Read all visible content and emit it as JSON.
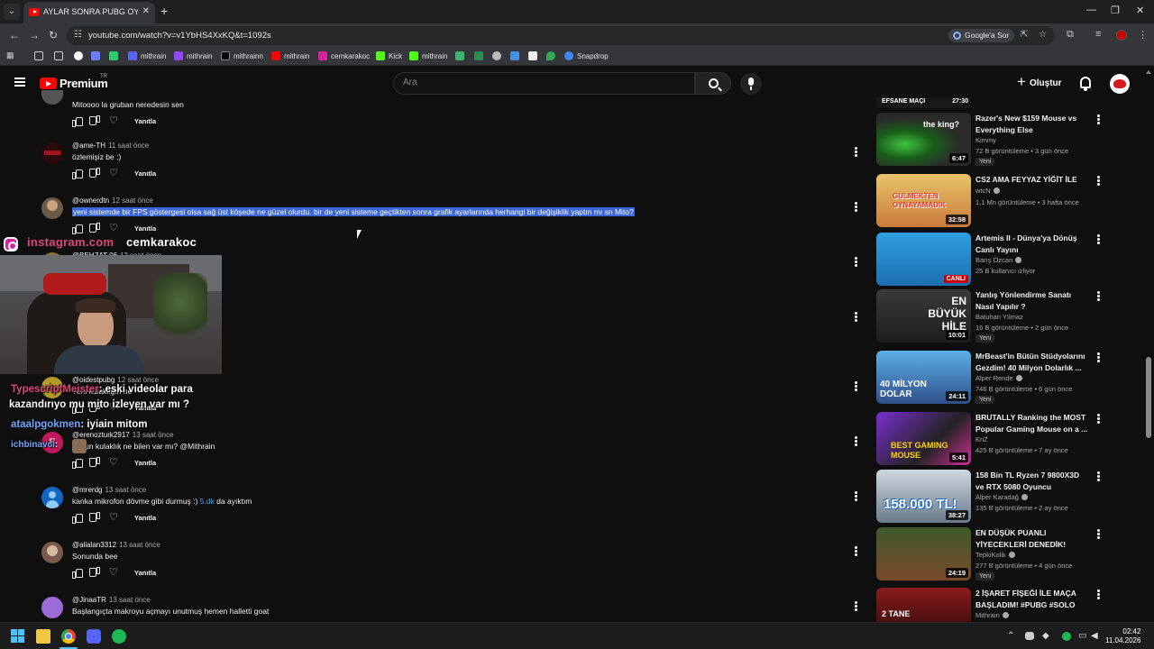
{
  "browser": {
    "tab_title": "AYLAR SONRA PUBG OYNADIM",
    "url": "youtube.com/watch?v=v1YbHS4XxKQ&t=1092s",
    "google_sor": "Google'a Sor",
    "bookmarks": [
      "mithrain",
      "mithrain",
      "mithrainn",
      "mithrain",
      "cemkarakoc",
      "Kick",
      "mithrain",
      "Snapdrop"
    ]
  },
  "header": {
    "premium": "Premium",
    "region": "TR",
    "search_placeholder": "Ara",
    "create": "Oluştur"
  },
  "comments": [
    {
      "user": "",
      "time": "",
      "text": "Mitoooo la gruban neredesin sen",
      "reply": "Yanıtla"
    },
    {
      "user": "@ame-TH",
      "time": "11 saat önce",
      "text": "özlemişiz be :)",
      "reply": "Yanıtla"
    },
    {
      "user": "@ownerdtn",
      "time": "12 saat önce",
      "text": "yeni sistemde bir FPS göstergesi olsa sağ üst köşede ne güzel olurdu. bir de yeni sisteme geçtikten sonra grafik ayarlarında herhangi bir değişiklik yaptın mı sn Mito?",
      "reply": "Yanıtla"
    },
    {
      "user": "@BEHZAT 06",
      "time": "12 saat önce",
      "text": "",
      "reply": ""
    },
    {
      "user": "@oidestpubg",
      "time": "12 saat önce",
      "text": "Yeni kulaklığın ne",
      "reply": "Yanıtla"
    },
    {
      "user": "@erenozturk2917",
      "time": "13 saat önce",
      "text": "...mun kulaklık ne bilen var mı? @Mithrain",
      "reply": "Yanıtla"
    },
    {
      "user": "@mrerdg",
      "time": "13 saat önce",
      "text_a": "kanka mikrofon dövme gibi durmuş :) ",
      "link": "5.dk",
      "text_b": " da ayıktım",
      "reply": "Yanıtla"
    },
    {
      "user": "@alialan3312",
      "time": "13 saat önce",
      "text": "Sonunda bee",
      "reply": "Yanıtla"
    },
    {
      "user": "@JinaaTR",
      "time": "13 saat önce",
      "text": "Başlangıçta makroyu açmayı unutmuş hemen halletti goat",
      "reply": ""
    }
  ],
  "overlay": {
    "insta_label": "instagram.com",
    "insta_handle": "cemkarakoc",
    "chat": [
      {
        "user": "TypescriptMeister",
        "msg": ": eski videolar para",
        "color": "#e0467c"
      },
      {
        "user": "",
        "msg": "kazandırıyo mu mito izleyen var mı ?",
        "color": "#ffffff"
      },
      {
        "user": "ataalpgokmen",
        "msg": ": iyiain mitom",
        "color": "#6fa8ff"
      },
      {
        "user": "ichbinavci",
        "msg": ":",
        "color": "#6fa8ff"
      }
    ]
  },
  "sidebar": {
    "top_partial_label": "EFSANE MAÇI",
    "top_partial_duration": "27:30",
    "items": [
      {
        "title": "Razer's New $159 Mouse vs Everything Else",
        "channel": "Kimmy",
        "verified": false,
        "stats": "72 B görüntüleme • 3 gün önce",
        "badge": "Yeni",
        "duration": "6:47",
        "thumb_text": "the king?"
      },
      {
        "title": "CS2 AMA FEYYAZ YİĞİT İLE",
        "channel": "wtcN",
        "verified": true,
        "stats": "1,1 Mn görüntüleme • 3 hafta önce",
        "badge": "",
        "duration": "32:58",
        "thumb_text": "GÜLMEKTEN OYNAYAMADIK"
      },
      {
        "title": "Artemis II - Dünya'ya Dönüş Canlı Yayını",
        "channel": "Barış Özcan",
        "verified": true,
        "stats": "25 B kullanıcı izliyor",
        "badge": "",
        "duration": "CANLI",
        "thumb_text": ""
      },
      {
        "title": "Yanlış Yönlendirme Sanatı Nasıl Yapılır ?",
        "channel": "Batuhan Yılmaz",
        "verified": false,
        "stats": "16 B görüntüleme • 2 gün önce",
        "badge": "Yeni",
        "duration": "10:01",
        "thumb_text": "EN BÜYÜK HİLE"
      },
      {
        "title": "MrBeast'in Bütün Stüdyolarını Gezdim! 40 Milyon Dolarlık ...",
        "channel": "Alper Rende",
        "verified": true,
        "stats": "746 B görüntüleme • 6 gün önce",
        "badge": "Yeni",
        "duration": "24:11",
        "thumb_text": "40 MİLYON DOLAR"
      },
      {
        "title": "BRUTALLY Ranking the MOST Popular Gaming Mouse on a ...",
        "channel": "KriZ",
        "verified": false,
        "stats": "425 B görüntüleme • 7 ay önce",
        "badge": "",
        "duration": "5:41",
        "thumb_text": "BEST GAMING MOUSE"
      },
      {
        "title": "158 Bin TL Ryzen 7 9800X3D ve RTX 5080 Oyuncu Bilgisayarı ...",
        "channel": "Alper Karadağ",
        "verified": true,
        "stats": "135 B görüntüleme • 2 ay önce",
        "badge": "",
        "duration": "38:27",
        "thumb_text": "158.000 TL!"
      },
      {
        "title": "EN DÜŞÜK PUANLI YİYECEKLERİ DENEDİK!",
        "channel": "TepkiKolik",
        "verified": true,
        "stats": "277 B görüntüleme • 4 gün önce",
        "badge": "Yeni",
        "duration": "24:19",
        "thumb_text": ""
      },
      {
        "title": "2 İŞARET FİŞEĞİ İLE MAÇA BAŞLADIM! #PUBG #SOLO",
        "channel": "Mithrain",
        "verified": true,
        "stats": "",
        "badge": "",
        "duration": "",
        "thumb_text": "2 TANE"
      }
    ]
  },
  "taskbar": {
    "time": "02:42",
    "date": "11.04.2026"
  }
}
